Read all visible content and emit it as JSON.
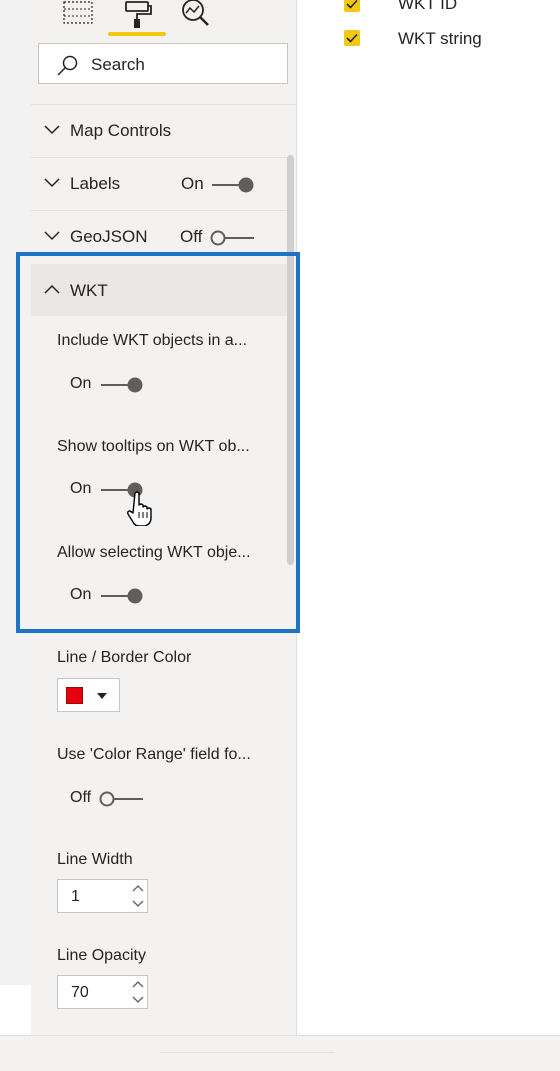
{
  "search": {
    "placeholder": "Search",
    "icon": "search-icon"
  },
  "format_tabs": [
    {
      "name": "fields",
      "icon": "fields-grid-icon"
    },
    {
      "name": "format",
      "icon": "paint-roller-icon",
      "active": true
    },
    {
      "name": "analytics",
      "icon": "analytics-magnifier-icon"
    }
  ],
  "sections": {
    "map_controls": {
      "label": "Map Controls"
    },
    "labels": {
      "label": "Labels",
      "toggle": "On"
    },
    "geojson": {
      "label": "GeoJSON",
      "toggle": "Off"
    },
    "wkt": {
      "label": "WKT"
    }
  },
  "wkt_props": {
    "include": {
      "label": "Include WKT objects in a...",
      "toggle": "On"
    },
    "tooltips": {
      "label": "Show tooltips on WKT ob...",
      "toggle": "On"
    },
    "selecting": {
      "label": "Allow selecting WKT obje...",
      "toggle": "On"
    }
  },
  "style_props": {
    "line_color": {
      "label": "Line / Border Color",
      "value": "#e8000b"
    },
    "color_range": {
      "label": "Use 'Color Range' field fo...",
      "toggle": "Off"
    },
    "line_width": {
      "label": "Line Width",
      "value": "1"
    },
    "line_opacity": {
      "label": "Line Opacity",
      "value": "70"
    }
  },
  "fields": [
    {
      "label": "WKT ID",
      "checked": true
    },
    {
      "label": "WKT string",
      "checked": true
    }
  ],
  "colors": {
    "accent_yellow": "#f2c811",
    "highlight_blue": "#1e73c8",
    "toggle_on": "#605e5c"
  }
}
